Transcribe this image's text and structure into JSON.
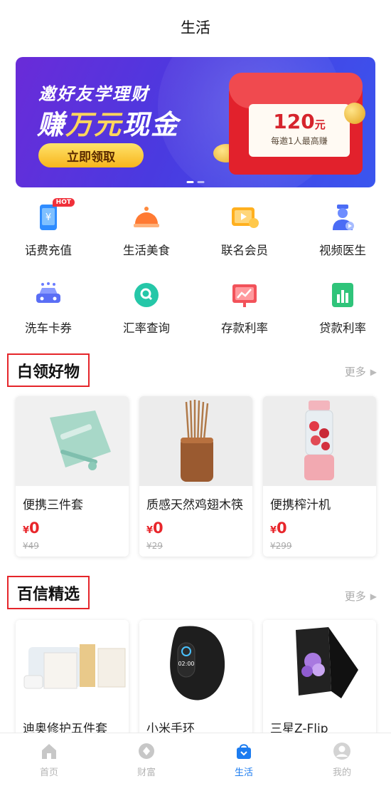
{
  "header": {
    "title": "生活"
  },
  "banner": {
    "headline": "邀好友学理财",
    "slogan_prefix": "赚",
    "slogan_highlight": "万元",
    "slogan_suffix": "现金",
    "cta_label": "立即领取",
    "amount": "120",
    "amount_unit": "元",
    "note": "每邀1人最高赚"
  },
  "services": [
    {
      "label": "话费充值",
      "icon": "phone-topup-icon",
      "badge": "HOT"
    },
    {
      "label": "生活美食",
      "icon": "food-cloche-icon"
    },
    {
      "label": "联名会员",
      "icon": "video-membership-icon"
    },
    {
      "label": "视频医生",
      "icon": "doctor-icon"
    },
    {
      "label": "洗车卡券",
      "icon": "car-wash-icon"
    },
    {
      "label": "汇率查询",
      "icon": "exchange-rate-icon"
    },
    {
      "label": "存款利率",
      "icon": "deposit-rate-icon"
    },
    {
      "label": "贷款利率",
      "icon": "loan-rate-icon"
    }
  ],
  "section1": {
    "title": "白领好物",
    "more": "更多",
    "products": [
      {
        "name": "便携三件套",
        "currency": "¥",
        "price": "0",
        "original": "¥49"
      },
      {
        "name": "质感天然鸡翅木筷",
        "currency": "¥",
        "price": "0",
        "original": "¥29"
      },
      {
        "name": "便携榨汁机",
        "currency": "¥",
        "price": "0",
        "original": "¥299"
      }
    ]
  },
  "section2": {
    "title": "百信精选",
    "more": "更多",
    "products": [
      {
        "name": "迪奥修护五件套"
      },
      {
        "name": "小米手环"
      },
      {
        "name": "三星Z-Flip"
      }
    ]
  },
  "tabbar": [
    {
      "label": "首页",
      "icon": "home-icon"
    },
    {
      "label": "财富",
      "icon": "wealth-icon"
    },
    {
      "label": "生活",
      "icon": "life-bag-icon",
      "active": true
    },
    {
      "label": "我的",
      "icon": "profile-icon"
    }
  ],
  "colors": {
    "accent": "#1c7cf0",
    "price": "#e8262b",
    "highlight_border": "#e5252a"
  }
}
